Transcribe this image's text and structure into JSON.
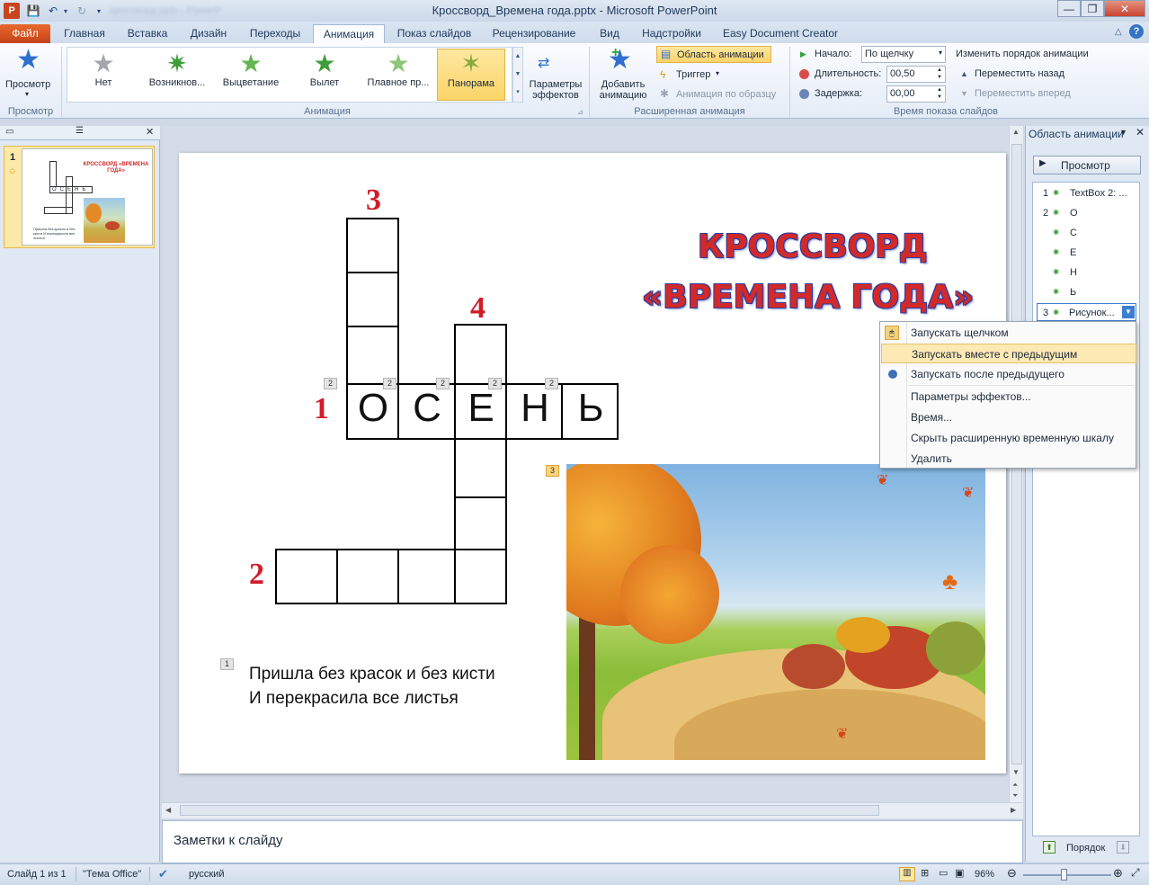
{
  "window": {
    "title": "Кроссворд_Времена года.pptx  -  Microsoft PowerPoint",
    "app_icon": "P",
    "blurred_tab": "кроссворд.pptx - PowerP"
  },
  "tabs": [
    "Файл",
    "Главная",
    "Вставка",
    "Дизайн",
    "Переходы",
    "Анимация",
    "Показ слайдов",
    "Рецензирование",
    "Вид",
    "Надстройки",
    "Easy Document Creator"
  ],
  "ribbon": {
    "preview": {
      "label": "Просмотр",
      "group": "Просмотр"
    },
    "gallery": [
      "Нет",
      "Возникнов...",
      "Выцветание",
      "Вылет",
      "Плавное пр...",
      "Панорама"
    ],
    "gallery_group": "Анимация",
    "effect_params": "Параметры эффектов",
    "add_animation": "Добавить анимацию",
    "anim_pane_btn": "Область анимации",
    "trigger": "Триггер",
    "anim_painter": "Анимация по образцу",
    "advanced_group": "Расширенная анимация",
    "start_label": "Начало:",
    "start_value": "По щелчку",
    "duration_label": "Длительность:",
    "duration_value": "00,50",
    "delay_label": "Задержка:",
    "delay_value": "00,00",
    "reorder_title": "Изменить порядок анимации",
    "move_earlier": "Переместить назад",
    "move_later": "Переместить вперед",
    "timing_group": "Время показа слайдов"
  },
  "thumbnail": {
    "slide_number": "1",
    "title": "КРОССВОРД «ВРЕМЕНА ГОДА»",
    "word": "ОСЕНЬ",
    "text": "Пришла без красок и без кисти И перекрасила все листья"
  },
  "slide": {
    "title_line1": "КРОССВОРД",
    "title_line2": "«ВРЕМЕНА ГОДА»",
    "numbers": [
      "1",
      "2",
      "3",
      "4"
    ],
    "word_letters": [
      "О",
      "С",
      "Е",
      "Н",
      "Ь"
    ],
    "anim_tags": [
      "2",
      "2",
      "2",
      "2",
      "2"
    ],
    "tag_picture": "3",
    "tag_text": "1",
    "riddle_line1": "Пришла без красок и без кисти",
    "riddle_line2": "И перекрасила все листья"
  },
  "notes_placeholder": "Заметки к слайду",
  "anim_pane": {
    "title": "Область анимации",
    "play_button": "Просмотр",
    "items": [
      {
        "num": "1",
        "label": "TextBox 2: ..."
      },
      {
        "num": "2",
        "label": "О"
      },
      {
        "num": "",
        "label": "С"
      },
      {
        "num": "",
        "label": "Е"
      },
      {
        "num": "",
        "label": "Н"
      },
      {
        "num": "",
        "label": "Ь"
      },
      {
        "num": "3",
        "label": "Рисунок..."
      }
    ],
    "reorder_label": "Порядок"
  },
  "context_menu": [
    "Запускать щелчком",
    "Запускать вместе с предыдущим",
    "Запускать после предыдущего",
    "Параметры эффектов...",
    "Время...",
    "Скрыть расширенную временную шкалу",
    "Удалить"
  ],
  "status": {
    "slide_info": "Слайд 1 из 1",
    "theme": "\"Тема Office\"",
    "language": "русский",
    "zoom": "96%"
  },
  "colors": {
    "accent_orange": "#c6421a",
    "title_red": "#d22a2a",
    "number_red": "#d11c2a",
    "star_green": "#3e9d3a"
  }
}
